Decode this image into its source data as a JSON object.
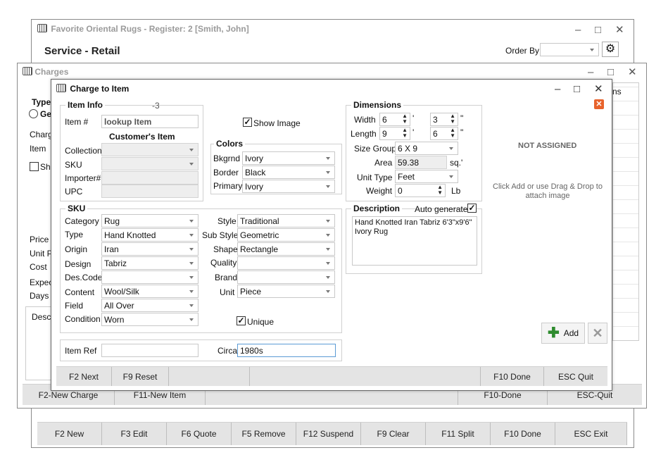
{
  "main_window": {
    "title": "Favorite Oriental Rugs -  Register: 2  [Smith, John]",
    "header": "Service - Retail",
    "order_by_label": "Order By",
    "order_by_value": "",
    "footer": [
      "F2 New",
      "F3 Edit",
      "F6 Quote",
      "F5 Remove",
      "F12 Suspend",
      "F9 Clear",
      "F11 Split",
      "F10 Done",
      "ESC Exit"
    ]
  },
  "charges_window": {
    "title": "Charges",
    "type_label": "Type",
    "radio_label": "Ge",
    "labels": [
      "Charg",
      "Item",
      "Sho",
      "Price",
      "Unit Pr",
      "Cost",
      "Expec",
      "Days",
      "Desc"
    ],
    "right_fragment": "ns",
    "footer": [
      "F2-New Charge",
      "F11-New Item",
      "",
      "F10-Done",
      "ESC-Quit"
    ]
  },
  "dialog": {
    "title": "Charge to Item",
    "item_info": {
      "header": "Item Info",
      "number_suffix": "-3",
      "item_no_label": "Item #",
      "item_no_value": "lookup Item",
      "customers_item": "Customer's Item",
      "collection_label": "Collection",
      "sku_label": "SKU",
      "importer_label": "Importer#",
      "upc_label": "UPC"
    },
    "show_image_label": "Show Image",
    "colors": {
      "header": "Colors",
      "rows": [
        {
          "label": "Bkgrnd",
          "value": "Ivory"
        },
        {
          "label": "Border",
          "value": "Black"
        },
        {
          "label": "Primary",
          "value": "Ivory"
        }
      ]
    },
    "dimensions": {
      "header": "Dimensions",
      "width_label": "Width",
      "width_ft": "6",
      "width_in": "3",
      "length_label": "Length",
      "length_ft": "9",
      "length_in": "6",
      "ft_mark": "'",
      "in_mark": "\"",
      "size_group_label": "Size Group",
      "size_group_value": "6 X 9",
      "area_label": "Area",
      "area_value": "59.38",
      "area_unit": "sq.'",
      "unit_type_label": "Unit Type",
      "unit_type_value": "Feet",
      "weight_label": "Weight",
      "weight_value": "0",
      "weight_unit": "Lb"
    },
    "image": {
      "status": "NOT ASSIGNED",
      "hint": "Click Add or use Drag & Drop to attach image",
      "add_label": "Add"
    },
    "sku": {
      "header": "SKU",
      "left": [
        {
          "label": "Category",
          "value": "Rug"
        },
        {
          "label": "Type",
          "value": "Hand Knotted"
        },
        {
          "label": "Origin",
          "value": "Iran"
        },
        {
          "label": "Design",
          "value": "Tabriz"
        },
        {
          "label": "Des.Code",
          "value": ""
        },
        {
          "label": "Content",
          "value": "Wool/Silk"
        },
        {
          "label": "Field",
          "value": "All Over"
        },
        {
          "label": "Condition",
          "value": "Worn"
        }
      ],
      "right": [
        {
          "label": "Style",
          "value": "Traditional"
        },
        {
          "label": "Sub Style",
          "value": "Geometric"
        },
        {
          "label": "Shape",
          "value": "Rectangle"
        },
        {
          "label": "Quality",
          "value": ""
        },
        {
          "label": "Brand",
          "value": ""
        },
        {
          "label": "Unit",
          "value": "Piece"
        }
      ],
      "unique_label": "Unique"
    },
    "description": {
      "header": "Description",
      "auto_label": "Auto generate",
      "text": "Hand Knotted Iran Tabriz 6'3\"x9'6\" Ivory Rug"
    },
    "item_ref_label": "Item Ref",
    "item_ref_value": "",
    "circa_label": "Circa",
    "circa_value": "1980s",
    "footer": [
      "F2 Next",
      "F9 Reset",
      "",
      "",
      "F10 Done",
      "ESC Quit"
    ]
  }
}
